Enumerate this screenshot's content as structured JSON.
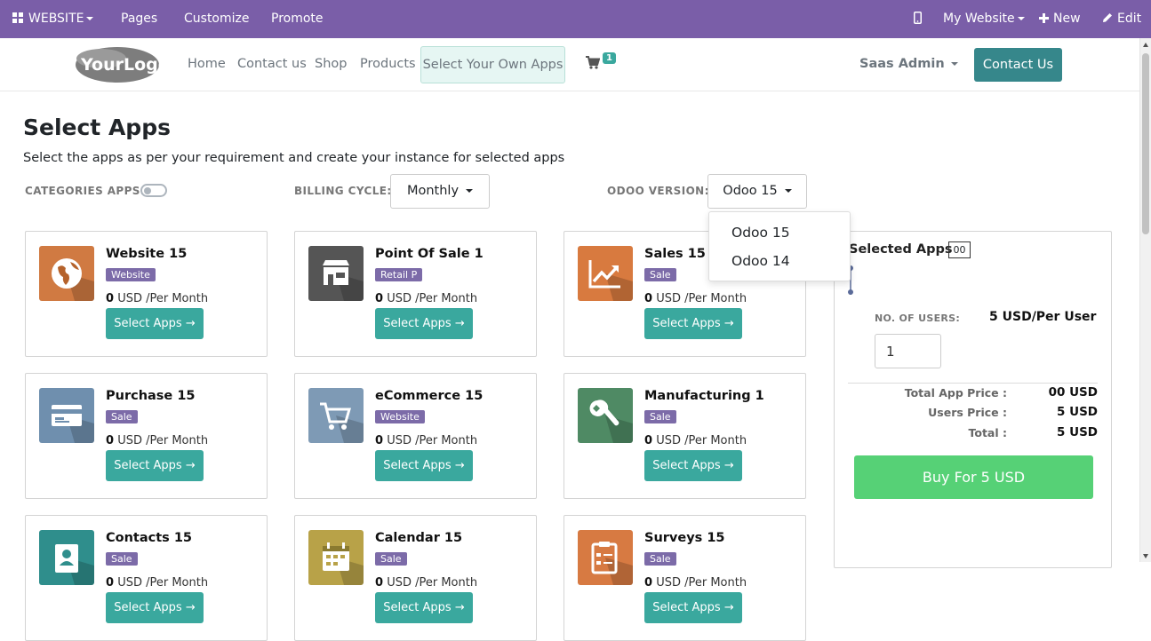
{
  "topbar": {
    "website_label": "WEBSITE",
    "pages_label": "Pages",
    "customize_label": "Customize",
    "promote_label": "Promote",
    "my_website_label": "My Website",
    "new_label": "New",
    "edit_label": "Edit"
  },
  "navbar": {
    "logo_text": "YourLogo",
    "links": [
      "Home",
      "Contact us",
      "Shop",
      "Products"
    ],
    "active_link": "Select Your Own Apps",
    "cart_count": "1",
    "user_name": "Saas Admin",
    "contact_button": "Contact Us"
  },
  "page": {
    "title": "Select Apps",
    "subtitle": "Select the apps as per your requirement and create your instance for selected apps"
  },
  "filters": {
    "categories_label": "CATEGORIES APPS:",
    "billing_label": "BILLING CYCLE:",
    "billing_value": "Monthly",
    "version_label": "ODOO VERSION:",
    "version_value": "Odoo 15",
    "version_options": [
      "Odoo 15",
      "Odoo 14"
    ]
  },
  "apps": [
    {
      "name": "Website 15",
      "category": "Website",
      "price": "0",
      "price_unit": "USD /Per Month",
      "button": "Select Apps",
      "color": "#d07a42"
    },
    {
      "name": "Point Of Sale 1",
      "category": "Retail P",
      "price": "0",
      "price_unit": "USD /Per Month",
      "button": "Select Apps",
      "color": "#555555"
    },
    {
      "name": "Sales 15",
      "category": "Sale",
      "price": "0",
      "price_unit": "USD /Per Month",
      "button": "Select Apps",
      "color": "#d87a3f"
    },
    {
      "name": "Purchase 15",
      "category": "Sale",
      "price": "0",
      "price_unit": "USD /Per Month",
      "button": "Select Apps",
      "color": "#6f8fae"
    },
    {
      "name": "eCommerce 15",
      "category": "Website",
      "price": "0",
      "price_unit": "USD /Per Month",
      "button": "Select Apps",
      "color": "#7e9ab5"
    },
    {
      "name": "Manufacturing 1",
      "category": "Sale",
      "price": "0",
      "price_unit": "USD /Per Month",
      "button": "Select Apps",
      "color": "#4f8a64"
    },
    {
      "name": "Contacts 15",
      "category": "Sale",
      "price": "0",
      "price_unit": "USD /Per Month",
      "button": "Select Apps",
      "color": "#2f8e8c"
    },
    {
      "name": "Calendar 15",
      "category": "Sale",
      "price": "0",
      "price_unit": "USD /Per Month",
      "button": "Select Apps",
      "color": "#b8a248"
    },
    {
      "name": "Surveys 15",
      "category": "Sale",
      "price": "0",
      "price_unit": "USD /Per Month",
      "button": "Select Apps",
      "color": "#d77a42"
    }
  ],
  "summary": {
    "title": "Selected Apps",
    "count": "00",
    "users_label": "NO. OF USERS:",
    "per_user_price": "5 USD/Per User",
    "users_value": "1",
    "total_app_price_label": "Total App Price :",
    "total_app_price": "00 USD",
    "users_price_label": "Users Price :",
    "users_price": "5 USD",
    "total_label": "Total :",
    "total": "5 USD",
    "buy_button": "Buy For 5 USD"
  }
}
